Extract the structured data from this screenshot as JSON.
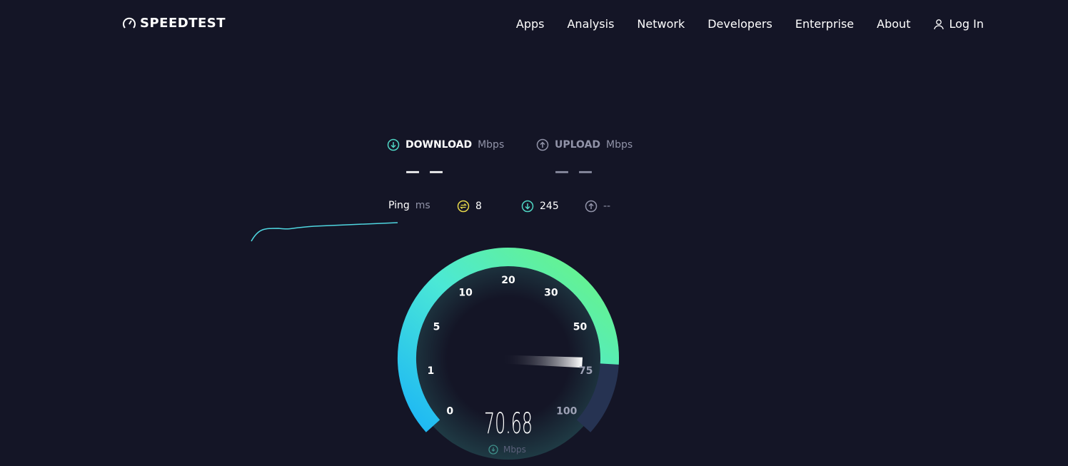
{
  "brand": "SPEEDTEST",
  "nav": [
    "Apps",
    "Analysis",
    "Network",
    "Developers",
    "Enterprise",
    "About"
  ],
  "login": "Log In",
  "download": {
    "label": "DOWNLOAD",
    "unit": "Mbps",
    "value": "— —"
  },
  "upload": {
    "label": "UPLOAD",
    "unit": "Mbps",
    "value": "— —"
  },
  "ping": {
    "label": "Ping",
    "unit": "ms",
    "idle": "8",
    "down": "245",
    "up": "--"
  },
  "gauge": {
    "ticks": [
      "0",
      "1",
      "5",
      "10",
      "20",
      "30",
      "50",
      "75",
      "100"
    ],
    "value": "70.68",
    "unit": "Mbps",
    "current": 70.68
  },
  "colors": {
    "bg": "#141526",
    "accent_start": "#1cb6f5",
    "accent_end": "#6cf57e",
    "ping_idle": "#e8d94a",
    "download": "#4fd6c4"
  }
}
